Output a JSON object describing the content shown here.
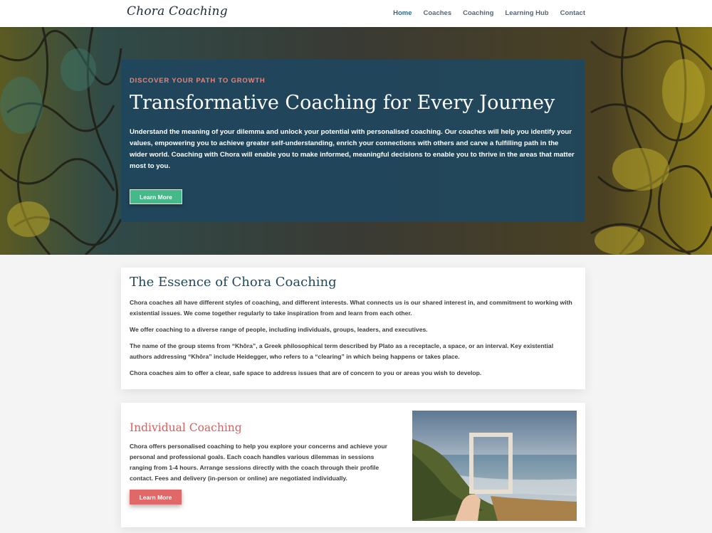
{
  "header": {
    "logo": "Chora Coaching",
    "nav": [
      "Home",
      "Coaches",
      "Coaching",
      "Learning Hub",
      "Contact"
    ],
    "active_nav": "Home"
  },
  "hero": {
    "eyebrow": "DISCOVER YOUR PATH TO GROWTH",
    "title": "Transformative Coaching for Every Journey",
    "text": "Understand the meaning of your dilemma and unlock your potential with personalised coaching. Our coaches will help you identify your values, empowering you to achieve greater self-understanding, enrich your connections with others and carve a fulfilling path in the wider world. Coaching with Chora will enable you to make informed, meaningful decisions to enable you to thrive in the areas that matter most to you.",
    "button": "Learn More"
  },
  "essence": {
    "title": "The Essence of Chora Coaching",
    "paragraphs": [
      "Chora coaches all have different styles of coaching, and different interests. What connects us is our shared interest in, and commitment to working with existential issues. We come together regularly to take inspiration from and learn from each other.",
      "We offer coaching to a diverse range of people, including individuals, groups, leaders, and executives.",
      "The name of the group stems from “Khôra”, a Greek philosophical term described by Plato as a receptacle, a space, or an interval. Key existential authors addressing “Khôra” include Heidegger, who refers to a “clearing” in which being happens or takes place.",
      "Chora coaches aim to offer a clear, safe space to address issues that are of concern to you or areas you wish to develop."
    ]
  },
  "individual": {
    "title": "Individual Coaching",
    "text": "Chora offers personalised coaching to help you explore your concerns and achieve your personal and professional goals. Each coach handles various dilemmas in sessions ranging from 1-4 hours. Arrange sessions directly with the coach through their profile contact. Fees and delivery (in-person or online) are negotiated individually.",
    "button": "Learn More"
  },
  "colors": {
    "hero_box": "#1f475e",
    "eyebrow": "#e3857c",
    "green_button": "#46b98a",
    "red_button": "#e06868",
    "heading_teal": "#1c4a5e",
    "heading_coral": "#d9605d",
    "nav_active": "#2e6a8e"
  }
}
